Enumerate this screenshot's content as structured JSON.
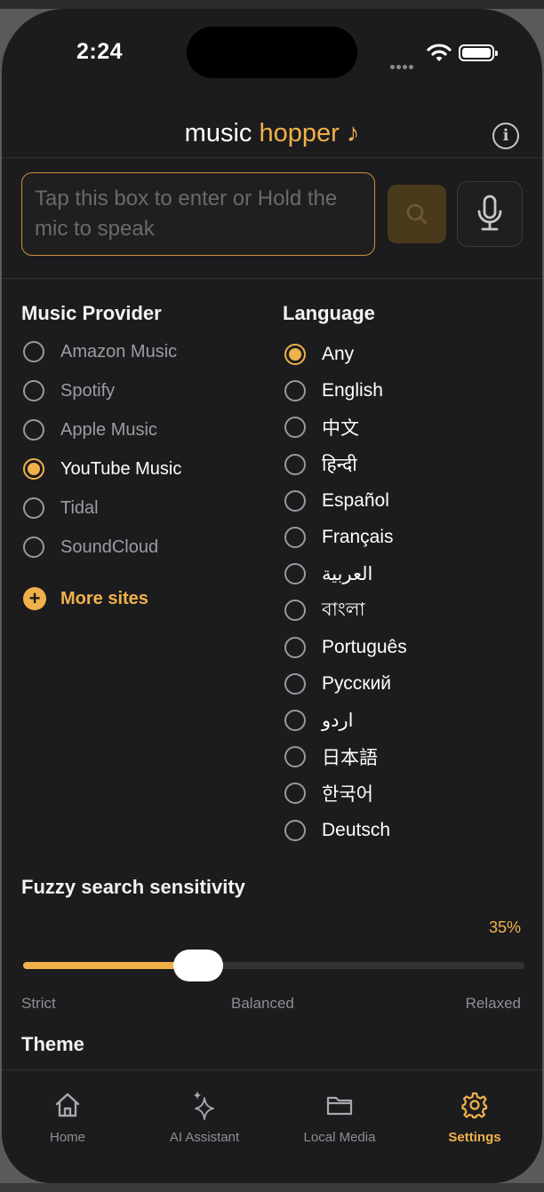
{
  "status_bar": {
    "time": "2:24"
  },
  "header": {
    "title_plain": "music",
    "title_accent": "hopper ♪",
    "info_icon": "info-icon"
  },
  "search": {
    "placeholder": "Tap this box to enter or Hold the mic to speak",
    "search_icon": "search-icon",
    "mic_icon": "microphone-icon"
  },
  "music_provider": {
    "title": "Music Provider",
    "options": [
      {
        "label": "Amazon Music",
        "selected": false
      },
      {
        "label": "Spotify",
        "selected": false
      },
      {
        "label": "Apple Music",
        "selected": false
      },
      {
        "label": "YouTube Music",
        "selected": true
      },
      {
        "label": "Tidal",
        "selected": false
      },
      {
        "label": "SoundCloud",
        "selected": false
      }
    ],
    "more_label": "More sites"
  },
  "language": {
    "title": "Language",
    "options": [
      {
        "label": "Any",
        "selected": true
      },
      {
        "label": "English",
        "selected": false
      },
      {
        "label": "中文",
        "selected": false
      },
      {
        "label": "हिन्दी",
        "selected": false
      },
      {
        "label": "Español",
        "selected": false
      },
      {
        "label": "Français",
        "selected": false
      },
      {
        "label": "العربية",
        "selected": false
      },
      {
        "label": "বাংলা",
        "selected": false
      },
      {
        "label": "Português",
        "selected": false
      },
      {
        "label": "Русский",
        "selected": false
      },
      {
        "label": "اردو",
        "selected": false
      },
      {
        "label": "日本語",
        "selected": false
      },
      {
        "label": "한국어",
        "selected": false
      },
      {
        "label": "Deutsch",
        "selected": false
      }
    ]
  },
  "fuzzy": {
    "title": "Fuzzy search sensitivity",
    "value_label": "35%",
    "value": 0.35,
    "strict_label": "Strict",
    "balanced_label": "Balanced",
    "relaxed_label": "Relaxed"
  },
  "theme": {
    "title": "Theme"
  },
  "tabs": [
    {
      "label": "Home",
      "icon": "home-icon",
      "active": false
    },
    {
      "label": "AI Assistant",
      "icon": "sparkles-icon",
      "active": false
    },
    {
      "label": "Local Media",
      "icon": "folder-icon",
      "active": false
    },
    {
      "label": "Settings",
      "icon": "gear-icon",
      "active": true
    }
  ],
  "colors": {
    "accent": "#f0b14a",
    "background": "#1c1c1e",
    "muted": "#8e8e93"
  }
}
